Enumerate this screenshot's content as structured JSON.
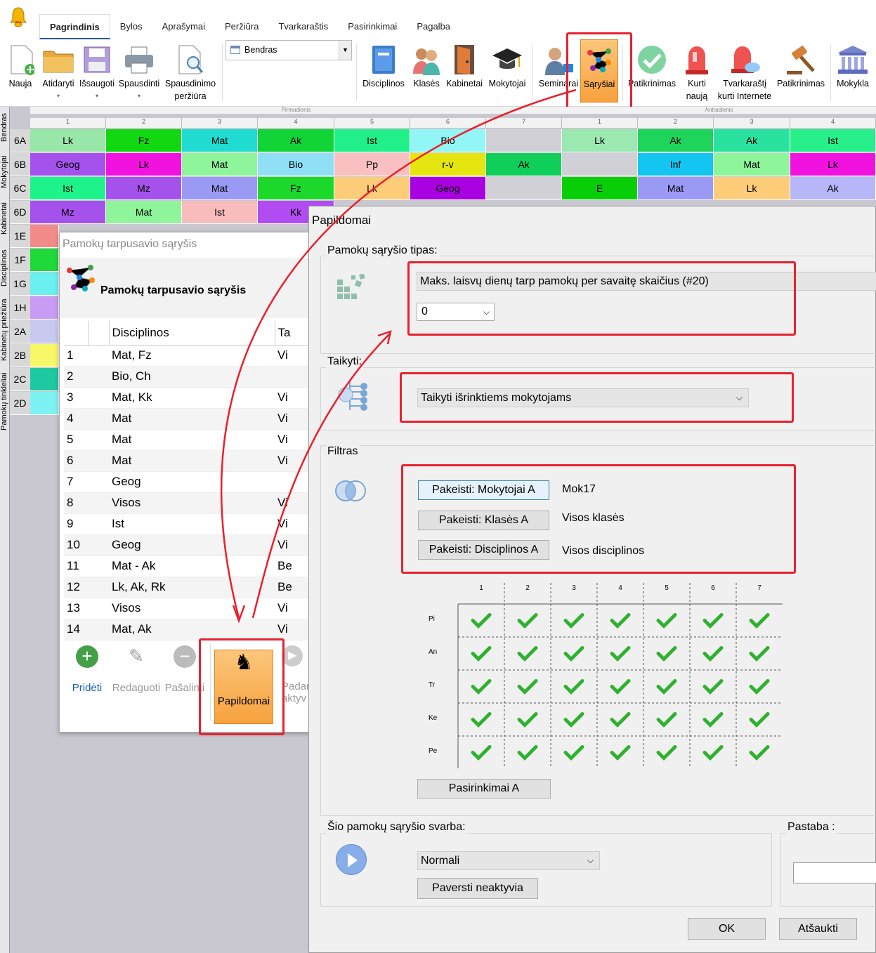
{
  "tabs": [
    "Pagrindinis",
    "Bylos",
    "Aprašymai",
    "Peržiūra",
    "Tvarkaraštis",
    "Pasirinkimai",
    "Pagalba"
  ],
  "ribbon": {
    "naujas": "Nauja",
    "atidaryti": "Atidaryti",
    "issaugoti": "Išsaugoti",
    "spausdinti": "Spausdinti",
    "spausdinimo": "Spausdinimo",
    "perziura": "peržiūra",
    "combo": "Bendras",
    "disciplinos": "Disciplinos",
    "klases": "Klasės",
    "kabinetai": "Kabinetai",
    "mokytojai": "Mokytojai",
    "seminarai": "Seminarai",
    "sarysiai": "Sąryšiai",
    "patikrinimas": "Patikrinimas",
    "kurti": "Kurti",
    "nauja2": "naują",
    "tvarkarasti": "Tvarkaraštį",
    "kurti_internete": "kurti Internete",
    "patikrinimas2": "Patikrinimas",
    "mokykla": "Mokykla"
  },
  "left_vtabs": [
    "Bendras",
    "Mokytojai",
    "Kabinetai",
    "Disciplinos",
    "Kabinetų priežiūra",
    "Pamokų tinkleliai"
  ],
  "grid": {
    "day1": "Pirmadienis",
    "day2": "Antradienis",
    "periods": [
      "1",
      "2",
      "3",
      "4",
      "5",
      "6",
      "7"
    ],
    "periods2": [
      "1",
      "2",
      "3",
      "4"
    ],
    "rows": [
      {
        "name": "6A",
        "cells": [
          "Lk",
          "Fz",
          "Mat",
          "Ak",
          "Ist",
          "Bio",
          "",
          "Lk",
          "Ak",
          "Ak",
          "Ist"
        ]
      },
      {
        "name": "6B",
        "cells": [
          "Geog",
          "Lk",
          "Mat",
          "Bio",
          "Pp",
          "r-v",
          "Ak",
          "",
          "Inf",
          "Mat",
          "Lk"
        ]
      },
      {
        "name": "6C",
        "cells": [
          "Ist",
          "Mz",
          "Mat",
          "Fz",
          "Lk",
          "Geog",
          "",
          "E",
          "Mat",
          "Lk",
          "Ak"
        ]
      },
      {
        "name": "6D",
        "cells": [
          "Mz",
          "Mat",
          "Ist",
          "Kk"
        ]
      },
      {
        "name": "1E"
      },
      {
        "name": "1F"
      },
      {
        "name": "1G"
      },
      {
        "name": "1H"
      },
      {
        "name": "2A"
      },
      {
        "name": "2B"
      },
      {
        "name": "2C"
      },
      {
        "name": "2D"
      }
    ]
  },
  "dlg1": {
    "title": "Pamokų tarpusavio sąryšis",
    "header": "Pamokų tarpusavio sąryšis",
    "col_disc": "Disciplinos",
    "col_ta": "Ta",
    "rows": [
      {
        "n": "1",
        "d": "Mat, Fz",
        "t": "Vi"
      },
      {
        "n": "2",
        "d": "Bio, Ch",
        "t": ""
      },
      {
        "n": "3",
        "d": "Mat, Kk",
        "t": "Vi"
      },
      {
        "n": "4",
        "d": "Mat",
        "t": "Vi"
      },
      {
        "n": "5",
        "d": "Mat",
        "t": "Vi"
      },
      {
        "n": "6",
        "d": "Mat",
        "t": "Vi"
      },
      {
        "n": "7",
        "d": "Geog",
        "t": ""
      },
      {
        "n": "8",
        "d": "Visos",
        "t": "Vi"
      },
      {
        "n": "9",
        "d": "Ist",
        "t": "Vi"
      },
      {
        "n": "10",
        "d": "Geog",
        "t": "Vi"
      },
      {
        "n": "11",
        "d": "Mat - Ak",
        "t": "Be"
      },
      {
        "n": "12",
        "d": "Lk, Ak, Rk",
        "t": "Be"
      },
      {
        "n": "13",
        "d": "Visos",
        "t": "Vi"
      },
      {
        "n": "14",
        "d": "Mat, Ak",
        "t": "Vi"
      }
    ],
    "btn_add": "Pridėti",
    "btn_edit": "Redaguoti",
    "btn_remove": "Pašalinti",
    "btn_extra": "Papildomai",
    "btn_make": "Padar",
    "btn_inactive": "aktyv"
  },
  "dlg2": {
    "title": "Papildomai",
    "grp_type": "Pamokų sąryšio tipas:",
    "type_value": "Maks. laisvų dienų tarp pamokų per savaitę skaičius (#20)",
    "num_value": "0",
    "grp_apply": "Taikyti:",
    "apply_value": "Taikyti išrinktiems mokytojams",
    "grp_filter": "Filtras",
    "btn_teachers": "Pakeisti: Mokytojai A",
    "val_teachers": "Mok17",
    "btn_classes": "Pakeisti: Klasės A",
    "val_classes": "Visos klasės",
    "btn_subjects": "Pakeisti: Disciplinos A",
    "val_subjects": "Visos disciplinos",
    "periods": [
      "1",
      "2",
      "3",
      "4",
      "5",
      "6",
      "7"
    ],
    "days": [
      "Pi",
      "An",
      "Tr",
      "Ke",
      "Pe"
    ],
    "btn_options": "Pasirinkimai A",
    "grp_weight": "Šio pamokų sąryšio svarba:",
    "weight_value": "Normali",
    "btn_inactive": "Paversti neaktyvia",
    "grp_note": "Pastaba :",
    "ok": "OK",
    "cancel": "Atšaukti"
  }
}
